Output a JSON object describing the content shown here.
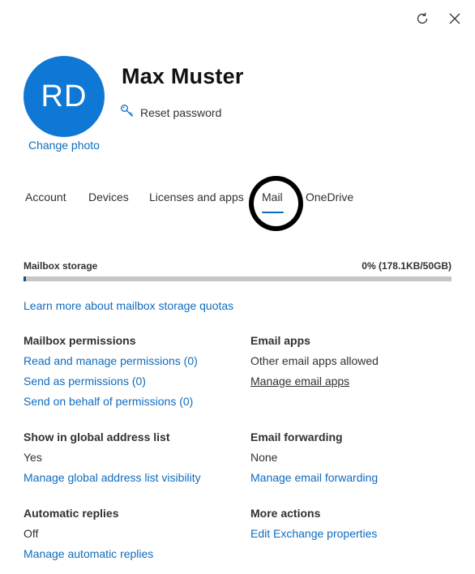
{
  "header": {
    "refresh_icon": "refresh-icon",
    "close_icon": "close-icon"
  },
  "profile": {
    "initials": "RD",
    "name": "Max Muster",
    "change_photo": "Change photo",
    "reset_password": "Reset password",
    "avatar_color": "#0f78d4"
  },
  "tabs": [
    {
      "label": "Account"
    },
    {
      "label": "Devices"
    },
    {
      "label": "Licenses and apps"
    },
    {
      "label": "Mail",
      "selected": true
    },
    {
      "label": "OneDrive"
    }
  ],
  "storage": {
    "label": "Mailbox storage",
    "value": "0% (178.1KB/50GB)",
    "used_percent": 0,
    "learn_more": "Learn more about mailbox storage quotas"
  },
  "mailbox_permissions": {
    "heading": "Mailbox permissions",
    "links": [
      "Read and manage permissions (0)",
      "Send as permissions (0)",
      "Send on behalf of permissions (0)"
    ]
  },
  "email_apps": {
    "heading": "Email apps",
    "value": "Other email apps allowed",
    "link": "Manage email apps"
  },
  "global_address": {
    "heading": "Show in global address list",
    "value": "Yes",
    "link": "Manage global address list visibility"
  },
  "email_forwarding": {
    "heading": "Email forwarding",
    "value": "None",
    "link": "Manage email forwarding"
  },
  "automatic_replies": {
    "heading": "Automatic replies",
    "value": "Off",
    "link": "Manage automatic replies"
  },
  "more_actions": {
    "heading": "More actions",
    "link": "Edit Exchange properties"
  },
  "colors": {
    "accent": "#0f6cbd",
    "storage_fill": "#005a9e",
    "storage_track": "#c8c6c4"
  }
}
